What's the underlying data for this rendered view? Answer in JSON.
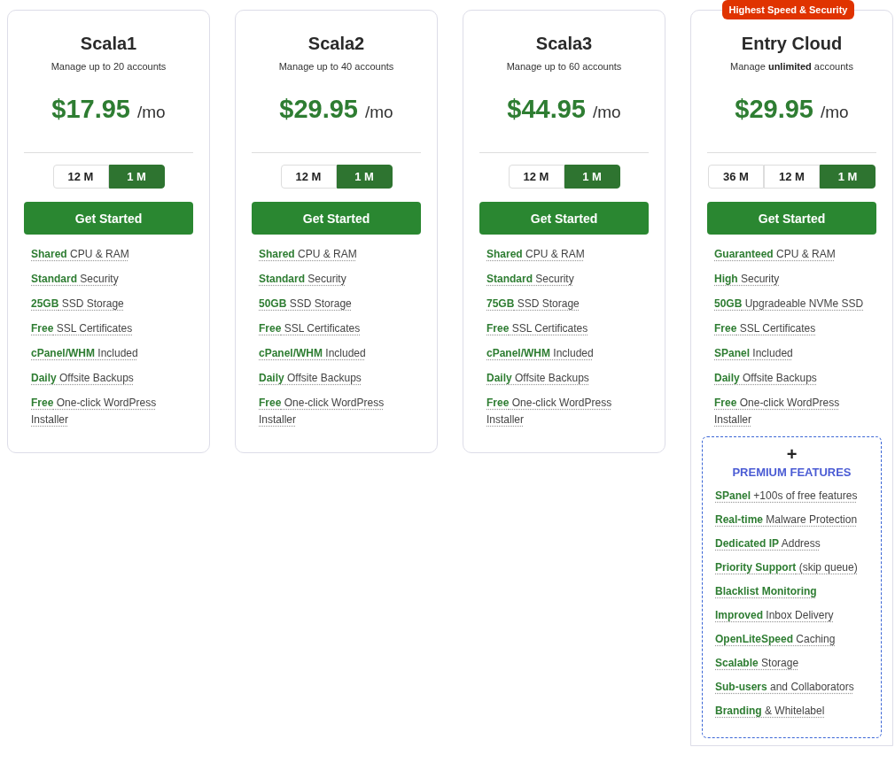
{
  "plans": [
    {
      "name": "Scala1",
      "subtitle": "Manage up to 20 accounts",
      "price": "$17.95",
      "per": "/mo",
      "periods": [
        {
          "label": "12 M",
          "selected": false
        },
        {
          "label": "1 M",
          "selected": true
        }
      ],
      "button": "Get Started",
      "features": [
        "**Shared** CPU & RAM",
        "**Standard** Security",
        "**25GB** SSD Storage",
        "**Free** SSL Certificates",
        "**cPanel/WHM** Included",
        "**Daily** Offsite Backups",
        "**Free** One-click WordPress Installer"
      ]
    },
    {
      "name": "Scala2",
      "subtitle": "Manage up to 40 accounts",
      "price": "$29.95",
      "per": "/mo",
      "periods": [
        {
          "label": "12 M",
          "selected": false
        },
        {
          "label": "1 M",
          "selected": true
        }
      ],
      "button": "Get Started",
      "features": [
        "**Shared** CPU & RAM",
        "**Standard** Security",
        "**50GB** SSD Storage",
        "**Free** SSL Certificates",
        "**cPanel/WHM** Included",
        "**Daily** Offsite Backups",
        "**Free** One-click WordPress Installer"
      ]
    },
    {
      "name": "Scala3",
      "subtitle": "Manage up to 60 accounts",
      "price": "$44.95",
      "per": "/mo",
      "periods": [
        {
          "label": "12 M",
          "selected": false
        },
        {
          "label": "1 M",
          "selected": true
        }
      ],
      "button": "Get Started",
      "features": [
        "**Shared** CPU & RAM",
        "**Standard** Security",
        "**75GB** SSD Storage",
        "**Free** SSL Certificates",
        "**cPanel/WHM** Included",
        "**Daily** Offsite Backups",
        "**Free** One-click WordPress Installer"
      ]
    },
    {
      "badge": "Highest Speed & Security",
      "name": "Entry Cloud",
      "subtitle": "Manage **unlimited** accounts",
      "price": "$29.95",
      "per": "/mo",
      "periods": [
        {
          "label": "36 M",
          "selected": false
        },
        {
          "label": "12 M",
          "selected": false
        },
        {
          "label": "1 M",
          "selected": true
        }
      ],
      "button": "Get Started",
      "features": [
        "**Guaranteed** CPU & RAM",
        "**High** Security",
        "**50GB** Upgradeable NVMe SSD",
        "**Free** SSL Certificates",
        "**SPanel** Included",
        "**Daily** Offsite Backups",
        "**Free** One-click WordPress Installer"
      ],
      "premium": {
        "icon": "+",
        "title": "PREMIUM FEATURES",
        "features": [
          "**SPanel** +100s of free features",
          "**Real-time** Malware Protection",
          "**Dedicated IP** Address",
          "**Priority Support** (skip queue)",
          "**Blacklist Monitoring**",
          "**Improved** Inbox Delivery",
          "**OpenLiteSpeed** Caching",
          "**Scalable** Storage",
          "**Sub-users** and Collaborators",
          "**Branding** & Whitelabel"
        ]
      }
    }
  ]
}
